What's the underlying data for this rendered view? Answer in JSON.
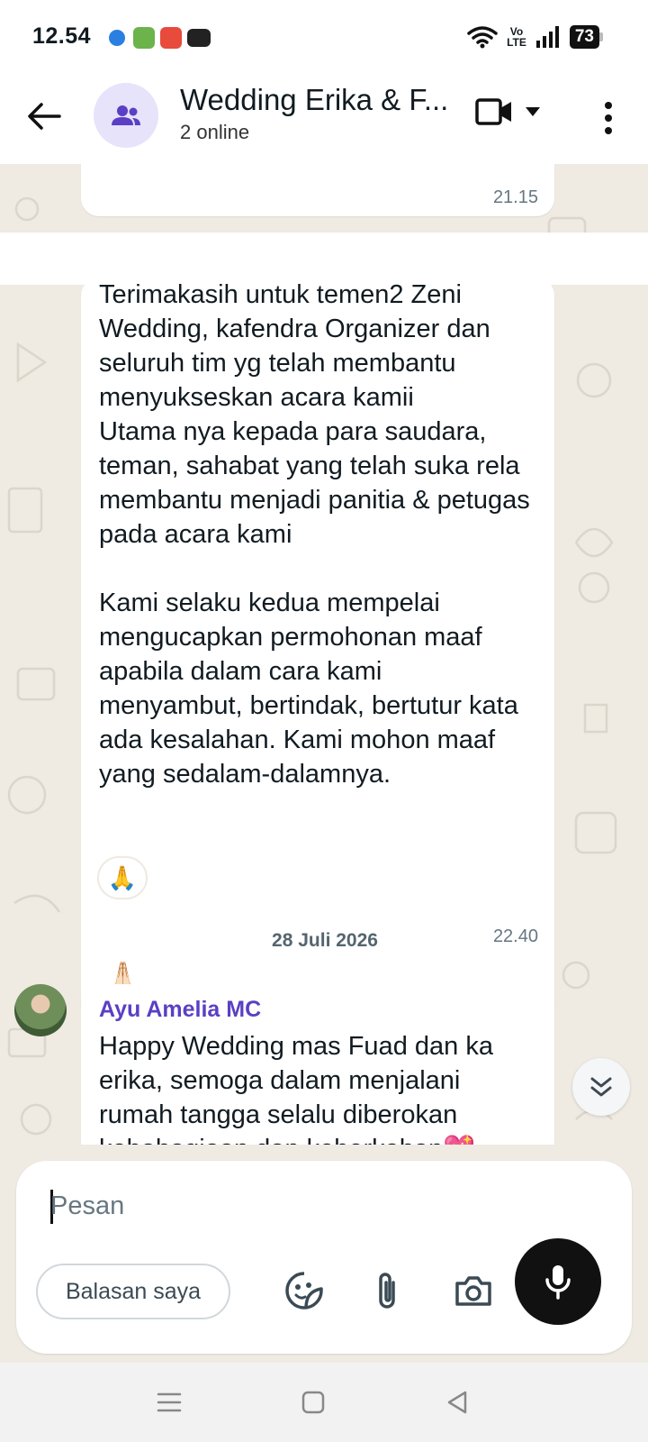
{
  "status_bar": {
    "time": "12.54",
    "network_label": "Vo\nLTE",
    "battery": "73",
    "notification_icons": [
      "edge-icon",
      "game-icon",
      "music-icon",
      "youtube-icon"
    ]
  },
  "header": {
    "title": "Wedding Erika & F...",
    "subtitle": "2 online",
    "avatar_icon": "group-icon"
  },
  "messages": [
    {
      "id": "m1",
      "time": "21.15"
    },
    {
      "id": "m2",
      "text": "Terimakasih untuk temen2 Zeni Wedding, kafendra Organizer dan seluruh tim yg telah membantu menyukseskan acara kamii\nUtama nya kepada para saudara, teman, sahabat yang telah suka rela membantu menjadi panitia & petugas pada acara kami\n\nKami selaku kedua mempelai mengucapkan permohonan maaf apabila dalam cara kami menyambut, bertindak, bertutur kata ada kesalahan. Kami mohon maaf yang sedalam-dalamnya.",
      "emoji": "🙏🏻",
      "time": "22.40",
      "reaction": "🙏"
    },
    {
      "id": "m3",
      "sender": "Ayu Amelia MC",
      "text": "Happy Wedding mas Fuad dan ka erika, semoga dalam menjalani rumah tangga selalu diberokan kebahagiaan dan keberkahan💖"
    }
  ],
  "date_separator": "28 Juli 2026",
  "composer": {
    "placeholder": "Pesan",
    "quick_reply": "Balasan saya"
  },
  "colors": {
    "chat_bg": "#efeae2",
    "sender_name": "#5b3fc4",
    "mic_button": "#111111",
    "avatar_bg": "#e6e3fa"
  }
}
